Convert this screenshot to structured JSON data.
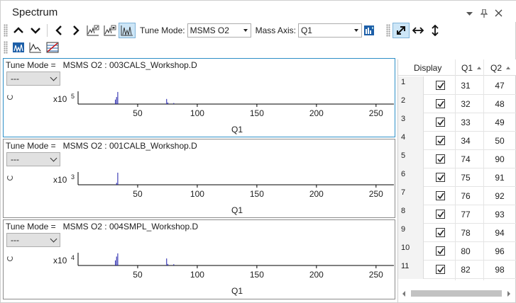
{
  "window": {
    "title": "Spectrum"
  },
  "toolbar": {
    "tune_mode_label": "Tune Mode:",
    "tune_mode_value": "MSMS O2",
    "mass_axis_label": "Mass Axis:",
    "mass_axis_value": "Q1"
  },
  "panes": [
    {
      "tune_mode_label": "Tune Mode =",
      "file": "MSMS O2 : 003CALS_Workshop.D",
      "select_value": "---",
      "scale_base": "x10",
      "scale_exp": "5",
      "x_ticks": [
        "50",
        "100",
        "150",
        "200",
        "250"
      ],
      "x_label": "Q1",
      "peaks": [
        {
          "x": 31,
          "y": 0.35
        },
        {
          "x": 32,
          "y": 0.55
        },
        {
          "x": 33,
          "y": 0.95
        },
        {
          "x": 74,
          "y": 0.4
        },
        {
          "x": 75,
          "y": 0.12
        },
        {
          "x": 80,
          "y": 0.08
        }
      ]
    },
    {
      "tune_mode_label": "Tune Mode =",
      "file": "MSMS O2 : 001CALB_Workshop.D",
      "select_value": "---",
      "scale_base": "x10",
      "scale_exp": "3",
      "x_ticks": [
        "50",
        "100",
        "150",
        "200",
        "250"
      ],
      "x_label": "Q1",
      "peaks": [
        {
          "x": 32,
          "y": 0.15
        },
        {
          "x": 33,
          "y": 0.95
        }
      ]
    },
    {
      "tune_mode_label": "Tune Mode =",
      "file": "MSMS O2 : 004SMPL_Workshop.D",
      "select_value": "---",
      "scale_base": "x10",
      "scale_exp": "4",
      "x_ticks": [
        "50",
        "100",
        "150",
        "200",
        "250"
      ],
      "x_label": "Q1",
      "peaks": [
        {
          "x": 31,
          "y": 0.4
        },
        {
          "x": 32,
          "y": 0.7
        },
        {
          "x": 33,
          "y": 0.95
        },
        {
          "x": 74,
          "y": 0.55
        },
        {
          "x": 75,
          "y": 0.12
        },
        {
          "x": 80,
          "y": 0.1
        }
      ]
    }
  ],
  "table": {
    "headers": {
      "display": "Display",
      "q1": "Q1",
      "q2": "Q2"
    },
    "rows": [
      {
        "n": "1",
        "q1": "31",
        "q2": "47"
      },
      {
        "n": "2",
        "q1": "32",
        "q2": "48"
      },
      {
        "n": "3",
        "q1": "33",
        "q2": "49"
      },
      {
        "n": "4",
        "q1": "34",
        "q2": "50"
      },
      {
        "n": "5",
        "q1": "74",
        "q2": "90"
      },
      {
        "n": "6",
        "q1": "75",
        "q2": "91"
      },
      {
        "n": "7",
        "q1": "76",
        "q2": "92"
      },
      {
        "n": "8",
        "q1": "77",
        "q2": "93"
      },
      {
        "n": "9",
        "q1": "78",
        "q2": "94"
      },
      {
        "n": "10",
        "q1": "80",
        "q2": "96"
      },
      {
        "n": "11",
        "q1": "82",
        "q2": "98"
      }
    ]
  },
  "colors": {
    "accent": "#2e8fc7",
    "peak": "#1a1aa8",
    "active_button": "#cde6f7"
  }
}
